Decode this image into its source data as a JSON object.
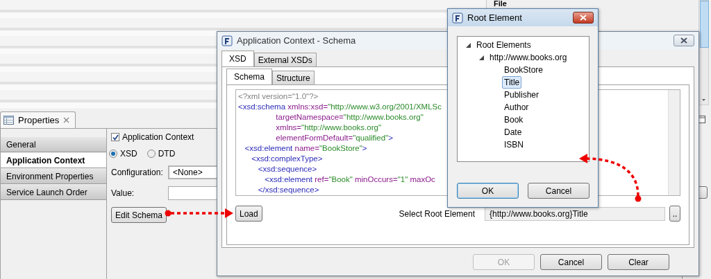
{
  "background_panel": {
    "header": "File"
  },
  "properties_view": {
    "title": "Properties",
    "sections": [
      {
        "label": "General",
        "selected": false
      },
      {
        "label": "Application Context",
        "selected": true
      },
      {
        "label": "Environment Properties",
        "selected": false
      },
      {
        "label": "Service Launch Order",
        "selected": false
      }
    ],
    "application_context": {
      "label": "Application Context",
      "checked": true
    },
    "schema_types": [
      {
        "label": "XSD",
        "selected": true
      },
      {
        "label": "DTD",
        "selected": false
      }
    ],
    "configuration": {
      "label": "Configuration:",
      "value": "<None>"
    },
    "value_field": {
      "label": "Value:"
    },
    "edit_schema_button": "Edit Schema"
  },
  "schema_dialog": {
    "title": "Application Context - Schema",
    "tabs": [
      {
        "label": "XSD",
        "selected": true
      },
      {
        "label": "External XSDs",
        "selected": false
      }
    ],
    "subtabs": [
      {
        "label": "Schema",
        "selected": true
      },
      {
        "label": "Structure",
        "selected": false
      }
    ],
    "code_lines": [
      [
        {
          "kind": "pi",
          "text": "<?xml version=\"1.0\"?>"
        }
      ],
      [
        {
          "kind": "tag",
          "text": "<xsd:schema "
        },
        {
          "kind": "attr",
          "text": "xmlns:xsd="
        },
        {
          "kind": "value",
          "text": "\"http://www.w3.org/2001/XMLSc"
        }
      ],
      [
        {
          "kind": "attr",
          "text": "                 targetNamespace="
        },
        {
          "kind": "value",
          "text": "\"http://www.books.org\""
        }
      ],
      [
        {
          "kind": "attr",
          "text": "                 xmlns="
        },
        {
          "kind": "value",
          "text": "\"http://www.books.org\""
        }
      ],
      [
        {
          "kind": "attr",
          "text": "                 elementFormDefault="
        },
        {
          "kind": "value",
          "text": "\"qualified\""
        },
        {
          "kind": "tag",
          "text": ">"
        }
      ],
      [
        {
          "kind": "tag",
          "text": "   <xsd:element "
        },
        {
          "kind": "attr",
          "text": "name="
        },
        {
          "kind": "value",
          "text": "\"BookStore\""
        },
        {
          "kind": "tag",
          "text": ">"
        }
      ],
      [
        {
          "kind": "tag",
          "text": "      <xsd:complexType>"
        }
      ],
      [
        {
          "kind": "tag",
          "text": "         <xsd:sequence>"
        }
      ],
      [
        {
          "kind": "tag",
          "text": "            <xsd:element "
        },
        {
          "kind": "attr",
          "text": "ref="
        },
        {
          "kind": "value",
          "text": "\"Book\" "
        },
        {
          "kind": "attr",
          "text": "minOccurs="
        },
        {
          "kind": "value",
          "text": "\"1\" "
        },
        {
          "kind": "attr",
          "text": "maxOc"
        }
      ],
      [
        {
          "kind": "tag",
          "text": "         </xsd:sequence>"
        }
      ]
    ],
    "load_button": "Load",
    "root_element": {
      "label": "Select Root Element",
      "value": "{http://www.books.org}Title"
    },
    "browse_button": "..",
    "buttons": [
      {
        "label": "OK",
        "disabled": true
      },
      {
        "label": "Cancel",
        "disabled": false
      },
      {
        "label": "Clear",
        "disabled": false
      }
    ]
  },
  "root_dialog": {
    "title": "Root Element",
    "tree": [
      {
        "label": "Root Elements",
        "expanded": true,
        "children": [
          {
            "label": "http://www.books.org",
            "expanded": true,
            "children": [
              {
                "label": "BookStore",
                "selected": false
              },
              {
                "label": "Title",
                "selected": true
              },
              {
                "label": "Publisher",
                "selected": false
              },
              {
                "label": "Author",
                "selected": false
              },
              {
                "label": "Book",
                "selected": false
              },
              {
                "label": "Date",
                "selected": false
              },
              {
                "label": "ISBN",
                "selected": false
              }
            ]
          }
        ]
      }
    ],
    "buttons": [
      {
        "label": "OK",
        "default": true
      },
      {
        "label": "Cancel",
        "default": false
      }
    ]
  }
}
